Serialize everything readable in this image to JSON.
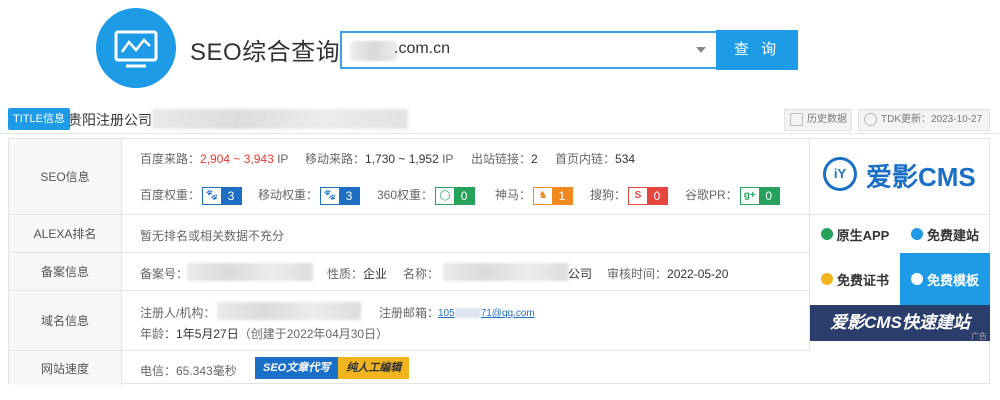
{
  "header": {
    "title": "SEO综合查询",
    "search_value": ".com.cn",
    "search_button": "查 询"
  },
  "title_bar": {
    "tag": "TITLE信息",
    "site_name": "贵阳注册公司",
    "history_button": "历史数据",
    "tdk_update": "TDK更新：2023-10-27"
  },
  "seo_info": {
    "label": "SEO信息",
    "baidu_traffic_label": "百度来路：",
    "baidu_traffic_value": "2,904 ~ 3,943",
    "baidu_traffic_unit": "IP",
    "mobile_traffic_label": "移动来路：",
    "mobile_traffic_value": "1,730 ~ 1,952",
    "mobile_traffic_unit": "IP",
    "outlinks_label": "出站链接：",
    "outlinks_value": "2",
    "homepage_links_label": "首页内链：",
    "homepage_links_value": "534",
    "ranks": [
      {
        "label": "百度权重：",
        "value": "3",
        "icon": "paw-icon",
        "color": "#1e6fc4"
      },
      {
        "label": "移动权重：",
        "value": "3",
        "icon": "paw-icon",
        "color": "#1e6fc4"
      },
      {
        "label": "360权重：",
        "value": "0",
        "icon": "360-icon",
        "color": "#26a35a"
      },
      {
        "label": "神马：",
        "value": "1",
        "icon": "shenma-icon",
        "color": "#f08a1e"
      },
      {
        "label": "搜狗：",
        "value": "0",
        "icon": "sogou-icon",
        "color": "#e5463f"
      },
      {
        "label": "谷歌PR：",
        "value": "0",
        "icon": "google-plus-icon",
        "color": "#26a35a"
      }
    ]
  },
  "alexa": {
    "label": "ALEXA排名",
    "value": "暂无排名或相关数据不充分"
  },
  "icp": {
    "label": "备案信息",
    "number_label": "备案号：",
    "nature_label": "性质：",
    "nature_value": "企业",
    "name_label": "名称：",
    "name_suffix": "公司",
    "review_label": "审核时间：",
    "review_value": "2022-05-20"
  },
  "domain": {
    "label": "域名信息",
    "registrant_label": "注册人/机构：",
    "email_label": "注册邮箱：",
    "email_prefix": "105",
    "email_suffix": "71@qq.com",
    "age_label": "年龄：",
    "age_value": "1年5月27日",
    "created_note": "（创建于2022年04月30日）"
  },
  "speed": {
    "label": "网站速度",
    "value": "电信：65.343毫秒",
    "ad_tag_1": "SEO文章代写",
    "ad_tag_2": "纯人工编辑"
  },
  "ad": {
    "logo_text": "爱影CMS",
    "btn_native_app": "原生APP",
    "btn_free_site": "免费建站",
    "btn_free_cert": "免费证书",
    "btn_free_template": "免费模板",
    "banner": "爱影CMS快速建站",
    "small_label": "广告"
  }
}
